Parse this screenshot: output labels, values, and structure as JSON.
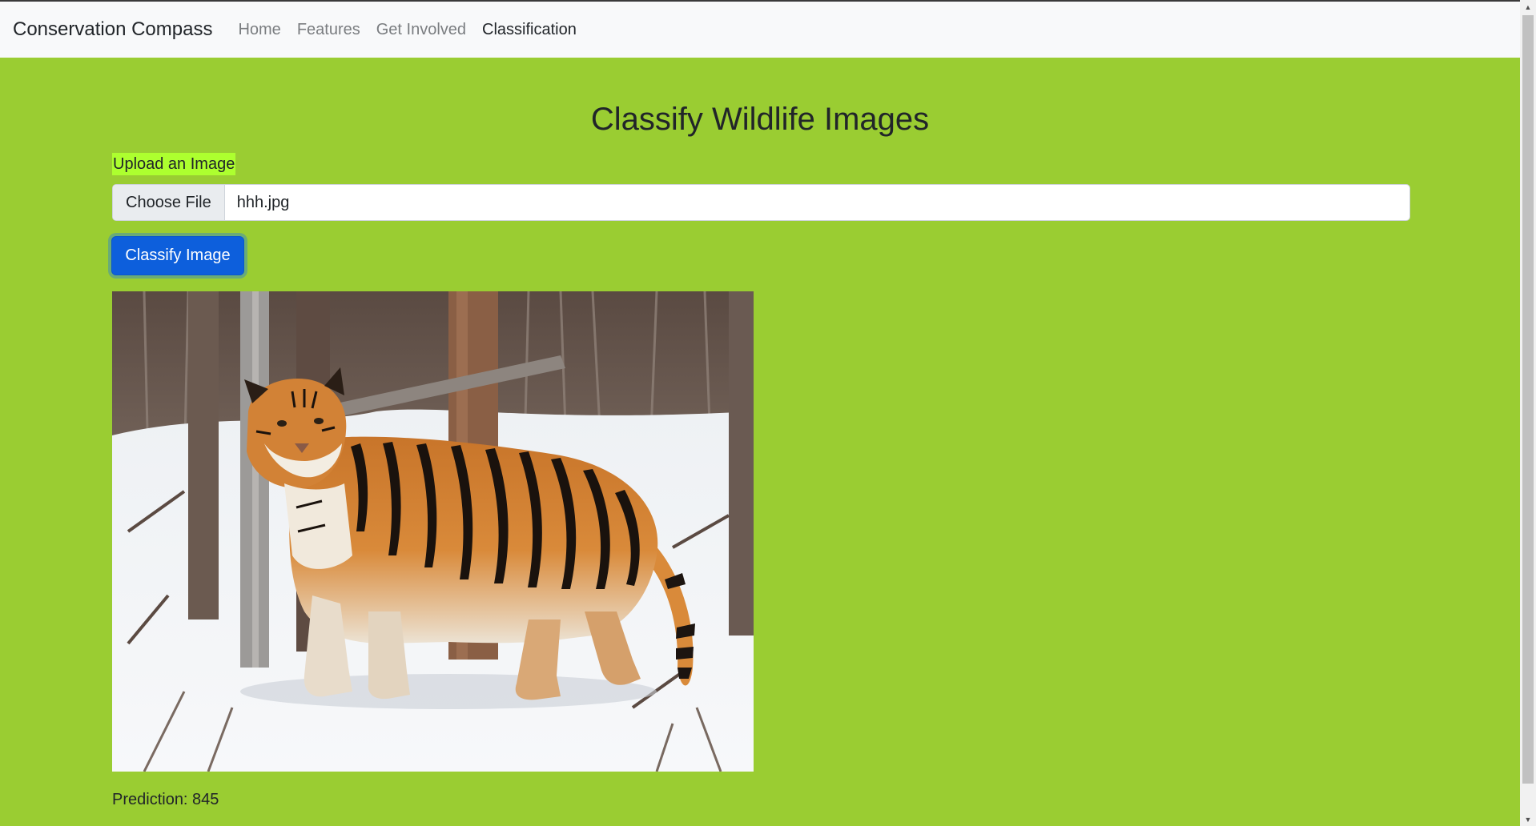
{
  "navbar": {
    "brand": "Conservation Compass",
    "links": [
      {
        "label": "Home",
        "active": false
      },
      {
        "label": "Features",
        "active": false
      },
      {
        "label": "Get Involved",
        "active": false
      },
      {
        "label": "Classification",
        "active": true
      }
    ]
  },
  "main": {
    "title": "Classify Wildlife Images",
    "upload_label": "Upload an Image",
    "file_input": {
      "button_label": "Choose File",
      "file_name": "hhh.jpg"
    },
    "classify_button": "Classify Image",
    "preview_image": "tiger-in-snow-image",
    "prediction_text": "Prediction: 845"
  },
  "colors": {
    "page_background": "#9acd32",
    "navbar_background": "#f8f9fa",
    "label_highlight": "#adff2f",
    "primary_button": "#0d5fdc"
  }
}
